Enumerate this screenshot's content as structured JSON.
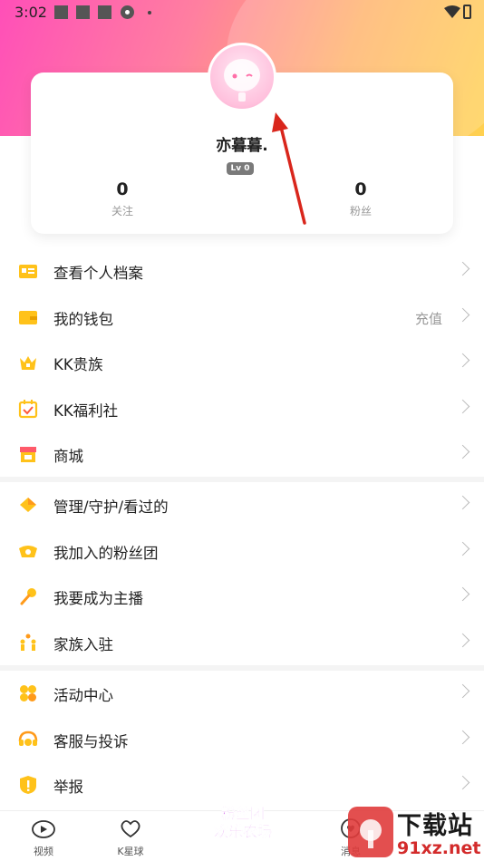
{
  "status_bar": {
    "time": "3:02"
  },
  "profile": {
    "nickname": "亦暮暮.",
    "level": "Lv 0",
    "following_count": "0",
    "following_label": "关注",
    "fans_count": "0",
    "fans_label": "粉丝"
  },
  "menu_group_1": [
    {
      "label": "查看个人档案",
      "icon": "profile-card-icon"
    },
    {
      "label": "我的钱包",
      "extra": "充值",
      "icon": "wallet-icon"
    },
    {
      "label": "KK贵族",
      "icon": "crown-icon"
    },
    {
      "label": "KK福利社",
      "icon": "calendar-check-icon"
    },
    {
      "label": "商城",
      "icon": "shop-icon"
    }
  ],
  "menu_group_2": [
    {
      "label": "管理/守护/看过的",
      "icon": "diamond-icon"
    },
    {
      "label": "我加入的粉丝团",
      "icon": "fan-club-icon"
    },
    {
      "label": "我要成为主播",
      "icon": "microphone-icon"
    },
    {
      "label": "家族入驻",
      "icon": "family-icon"
    }
  ],
  "menu_group_3": [
    {
      "label": "活动中心",
      "icon": "activity-icon"
    },
    {
      "label": "客服与投诉",
      "icon": "headset-icon"
    },
    {
      "label": "举报",
      "icon": "report-icon"
    }
  ],
  "bottom_nav": {
    "video": "视频",
    "planet": "K星球",
    "promo_line1": "粉丝团",
    "promo_line2": "欢乐农场",
    "message": "消息"
  },
  "watermark": {
    "line1": "下载站",
    "line2": "91xz.net"
  },
  "colors": {
    "brand_pink": "#ff4fb8",
    "brand_yellow": "#ffd84a",
    "icon_yellow": "#ffc21a",
    "annotation_red": "#d9261c"
  }
}
